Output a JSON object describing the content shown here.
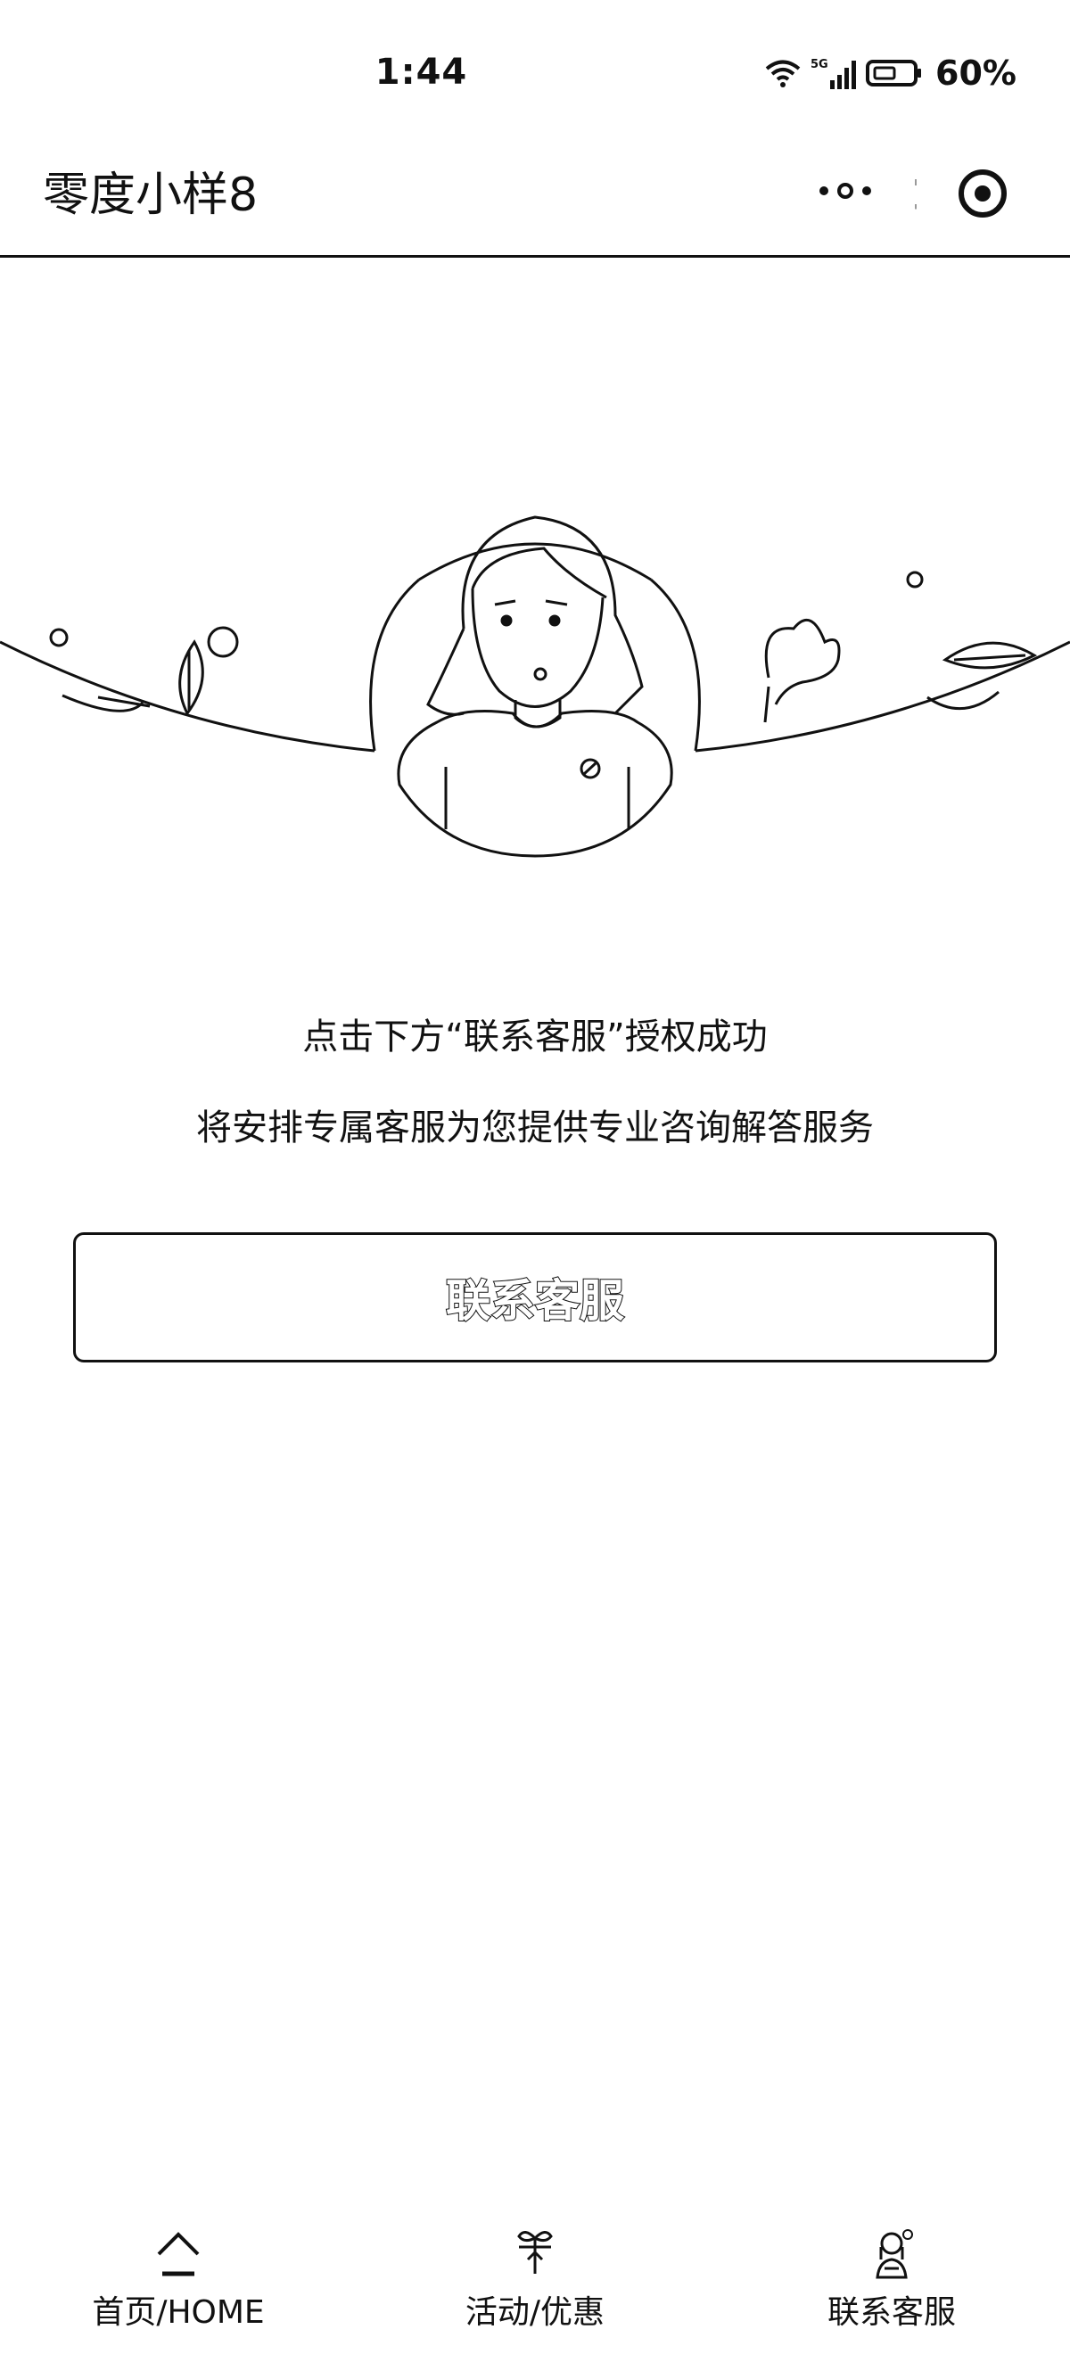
{
  "status_bar": {
    "time": "1:44",
    "network": "5G",
    "battery": "60%"
  },
  "header": {
    "title": "零度小样8",
    "icons": [
      "more-icon",
      "close-target-icon"
    ]
  },
  "main": {
    "message_line1": "点击下方“联系客服”授权成功",
    "message_line2": "将安排专属客服为您提供专业咨询解答服务",
    "contact_button_label": "联系客服"
  },
  "tab_bar": {
    "items": [
      {
        "label": "首页/HOME",
        "icon": "home-icon"
      },
      {
        "label": "活动/优惠",
        "icon": "gift-icon"
      },
      {
        "label": "联系客服",
        "icon": "customer-service-icon"
      }
    ]
  }
}
